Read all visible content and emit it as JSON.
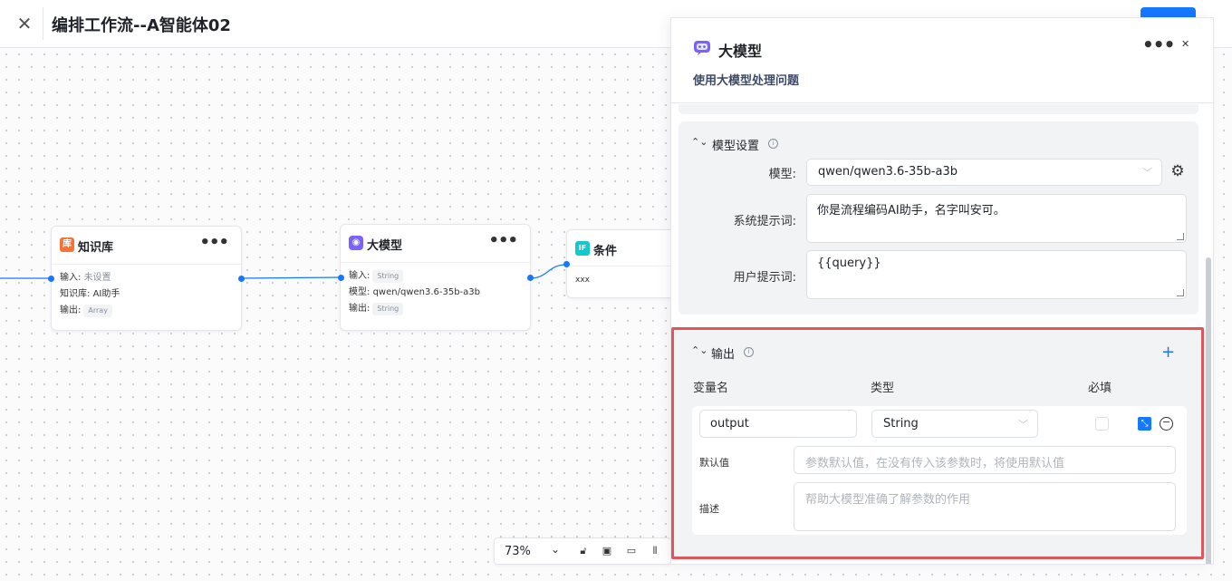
{
  "header": {
    "title": "编排工作流--A智能体02"
  },
  "canvas": {
    "nodes": {
      "knowledge": {
        "title": "知识库",
        "input_label": "输入:",
        "input_value": "未设置",
        "kb_label": "知识库:",
        "kb_value": "AI助手",
        "output_label": "输出:",
        "output_type": "Array"
      },
      "llm": {
        "title": "大模型",
        "input_label": "输入:",
        "input_type": "String",
        "model_label": "模型:",
        "model_value": "qwen/qwen3.6-35b-a3b",
        "output_label": "输出:",
        "output_type": "String"
      },
      "condition": {
        "icon_text": "IF",
        "title": "条件",
        "body": "xxx"
      }
    },
    "colors": {
      "accent": "#1677ff",
      "kb_icon": "#f77234",
      "if_icon": "#14c9c9",
      "llm_icon": "#7b61ff"
    }
  },
  "zoombar": {
    "zoom": "73%"
  },
  "panel": {
    "title": "大模型",
    "description": "使用大模型处理问题",
    "model_section": {
      "title": "模型设置",
      "model_label": "模型:",
      "model_value": "qwen/qwen3.6-35b-a3b",
      "system_prompt_label": "系统提示词:",
      "system_prompt_value": "你是流程编码AI助手，名字叫安可。",
      "user_prompt_label": "用户提示词:",
      "user_prompt_value": "{{query}}"
    },
    "output_section": {
      "title": "输出",
      "col_name": "变量名",
      "col_type": "类型",
      "col_required": "必填",
      "var_name": "output",
      "var_type": "String",
      "default_label": "默认值",
      "default_placeholder": "参数默认值，在没有传入该参数时，将使用默认值",
      "desc_label": "描述",
      "desc_placeholder": "帮助大模型准确了解参数的作用"
    }
  }
}
